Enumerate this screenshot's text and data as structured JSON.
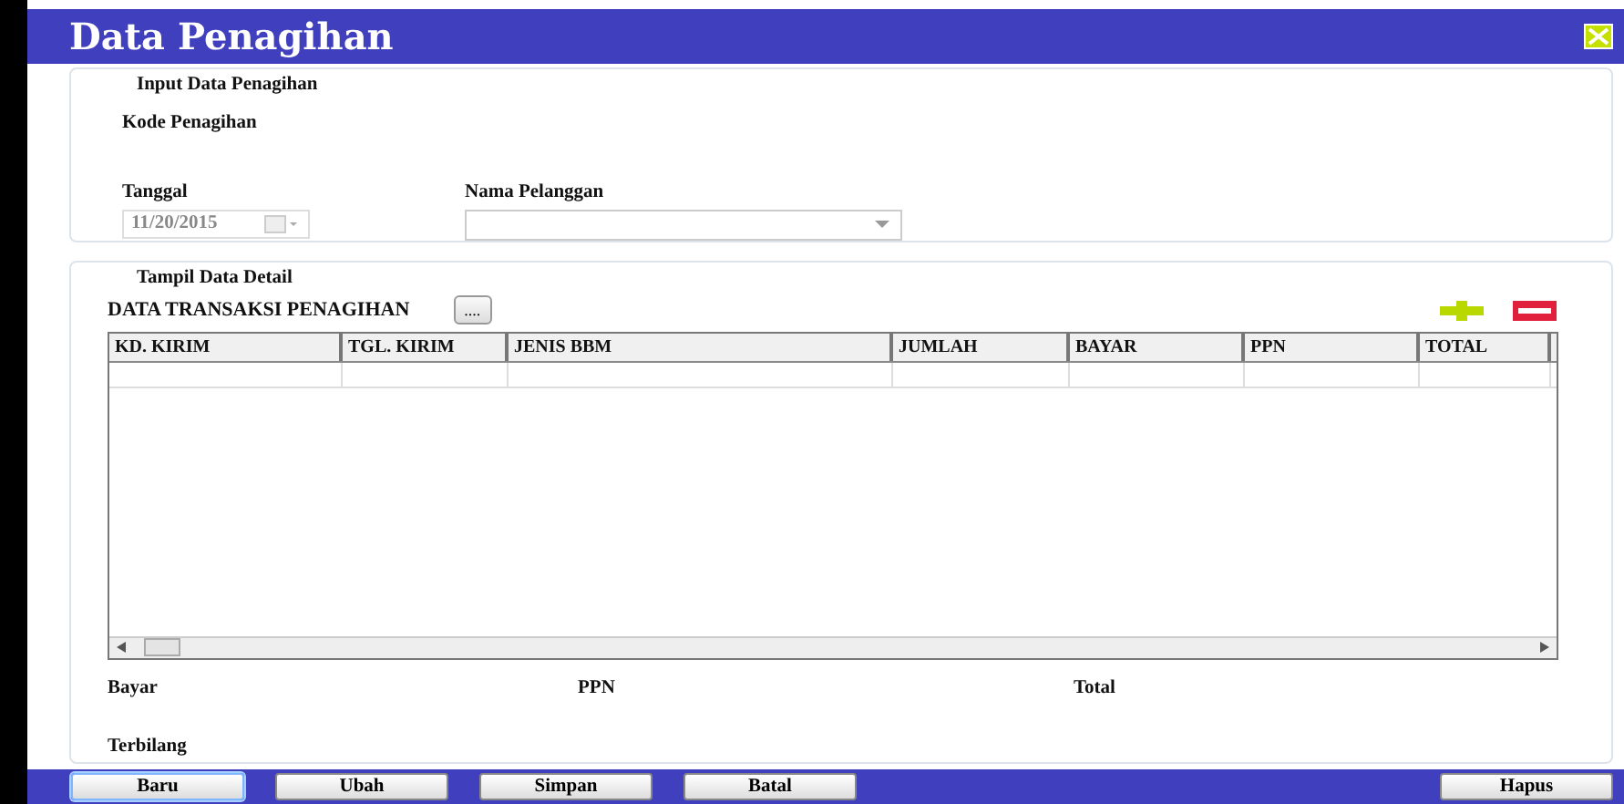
{
  "window": {
    "title": "Data Penagihan"
  },
  "input_section": {
    "legend": "Input Data Penagihan",
    "kode_label": "Kode Penagihan",
    "tanggal_label": "Tanggal",
    "tanggal_value": "11/20/2015",
    "nama_label": "Nama Pelanggan"
  },
  "detail_section": {
    "legend": "Tampil Data Detail",
    "heading": "DATA TRANSAKSI PENAGIHAN",
    "browse_button": "....",
    "table": {
      "columns": [
        "KD. KIRIM",
        "TGL. KIRIM",
        "JENIS BBM",
        "JUMLAH",
        "BAYAR",
        "PPN",
        "TOTAL"
      ]
    },
    "summary_labels": [
      "Bayar",
      "PPN",
      "Total"
    ],
    "terbilang_label": "Terbilang"
  },
  "footer_buttons": [
    {
      "label": "Baru",
      "selected": true
    },
    {
      "label": "Ubah",
      "selected": false
    },
    {
      "label": "Simpan",
      "selected": false
    },
    {
      "label": "Batal",
      "selected": false
    },
    {
      "label": "Hapus",
      "selected": false
    }
  ]
}
